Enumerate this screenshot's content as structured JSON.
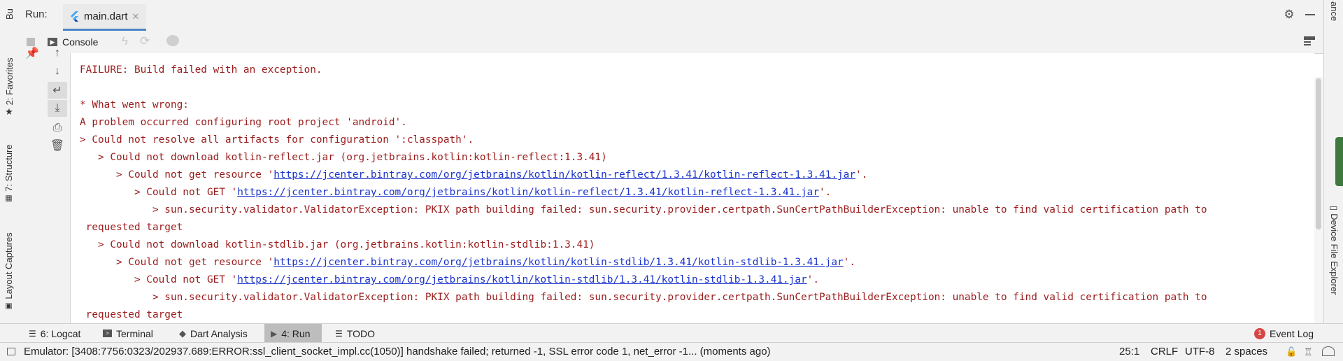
{
  "left_strip": {
    "top_label": "Bu",
    "favorites": "2: Favorites",
    "structure": "7: Structure",
    "layout_captures": "Layout Captures"
  },
  "right_strip": {
    "top_label": "ance",
    "device_file_explorer": "Device File Explorer"
  },
  "run_panel": {
    "run_label": "Run:",
    "tab_label": "main.dart",
    "console_tab": "Console"
  },
  "console": {
    "lines": [
      {
        "text": "FAILURE: Build failed with an exception."
      },
      {
        "text": ""
      },
      {
        "text": "* What went wrong:"
      },
      {
        "text": "A problem occurred configuring root project 'android'."
      },
      {
        "text": "> Could not resolve all artifacts for configuration ':classpath'."
      },
      {
        "text": "   > Could not download kotlin-reflect.jar (org.jetbrains.kotlin:kotlin-reflect:1.3.41)"
      },
      {
        "pre": "      > Could not get resource '",
        "link": "https://jcenter.bintray.com/org/jetbrains/kotlin/kotlin-reflect/1.3.41/kotlin-reflect-1.3.41.jar",
        "post": "'."
      },
      {
        "pre": "         > Could not GET '",
        "link": "https://jcenter.bintray.com/org/jetbrains/kotlin/kotlin-reflect/1.3.41/kotlin-reflect-1.3.41.jar",
        "post": "'."
      },
      {
        "text": "            > sun.security.validator.ValidatorException: PKIX path building failed: sun.security.provider.certpath.SunCertPathBuilderException: unable to find valid certification path to"
      },
      {
        "text": " requested target"
      },
      {
        "text": "   > Could not download kotlin-stdlib.jar (org.jetbrains.kotlin:kotlin-stdlib:1.3.41)"
      },
      {
        "pre": "      > Could not get resource '",
        "link": "https://jcenter.bintray.com/org/jetbrains/kotlin/kotlin-stdlib/1.3.41/kotlin-stdlib-1.3.41.jar",
        "post": "'."
      },
      {
        "pre": "         > Could not GET '",
        "link": "https://jcenter.bintray.com/org/jetbrains/kotlin/kotlin-stdlib/1.3.41/kotlin-stdlib-1.3.41.jar",
        "post": "'."
      },
      {
        "text": "            > sun.security.validator.ValidatorException: PKIX path building failed: sun.security.provider.certpath.SunCertPathBuilderException: unable to find valid certification path to"
      },
      {
        "text": " requested target"
      }
    ]
  },
  "bottom_tabs": {
    "logcat": "6: Logcat",
    "terminal": "Terminal",
    "dart_analysis": "Dart Analysis",
    "run": "4: Run",
    "todo": "TODO",
    "event_log": "Event Log",
    "event_log_badge": "1"
  },
  "status_bar": {
    "message": "Emulator: [3408:7756:0323/202937.689:ERROR:ssl_client_socket_impl.cc(1050)] handshake failed; returned -1, SSL error code 1, net_error -1... (moments ago)",
    "position": "25:1",
    "line_separator": "CRLF",
    "encoding": "UTF-8",
    "indent": "2 spaces"
  },
  "colors": {
    "error_text": "#9b1c1c",
    "link": "#1a33cc",
    "badge": "#d64545",
    "flutter_blue": "#42a5f5"
  }
}
